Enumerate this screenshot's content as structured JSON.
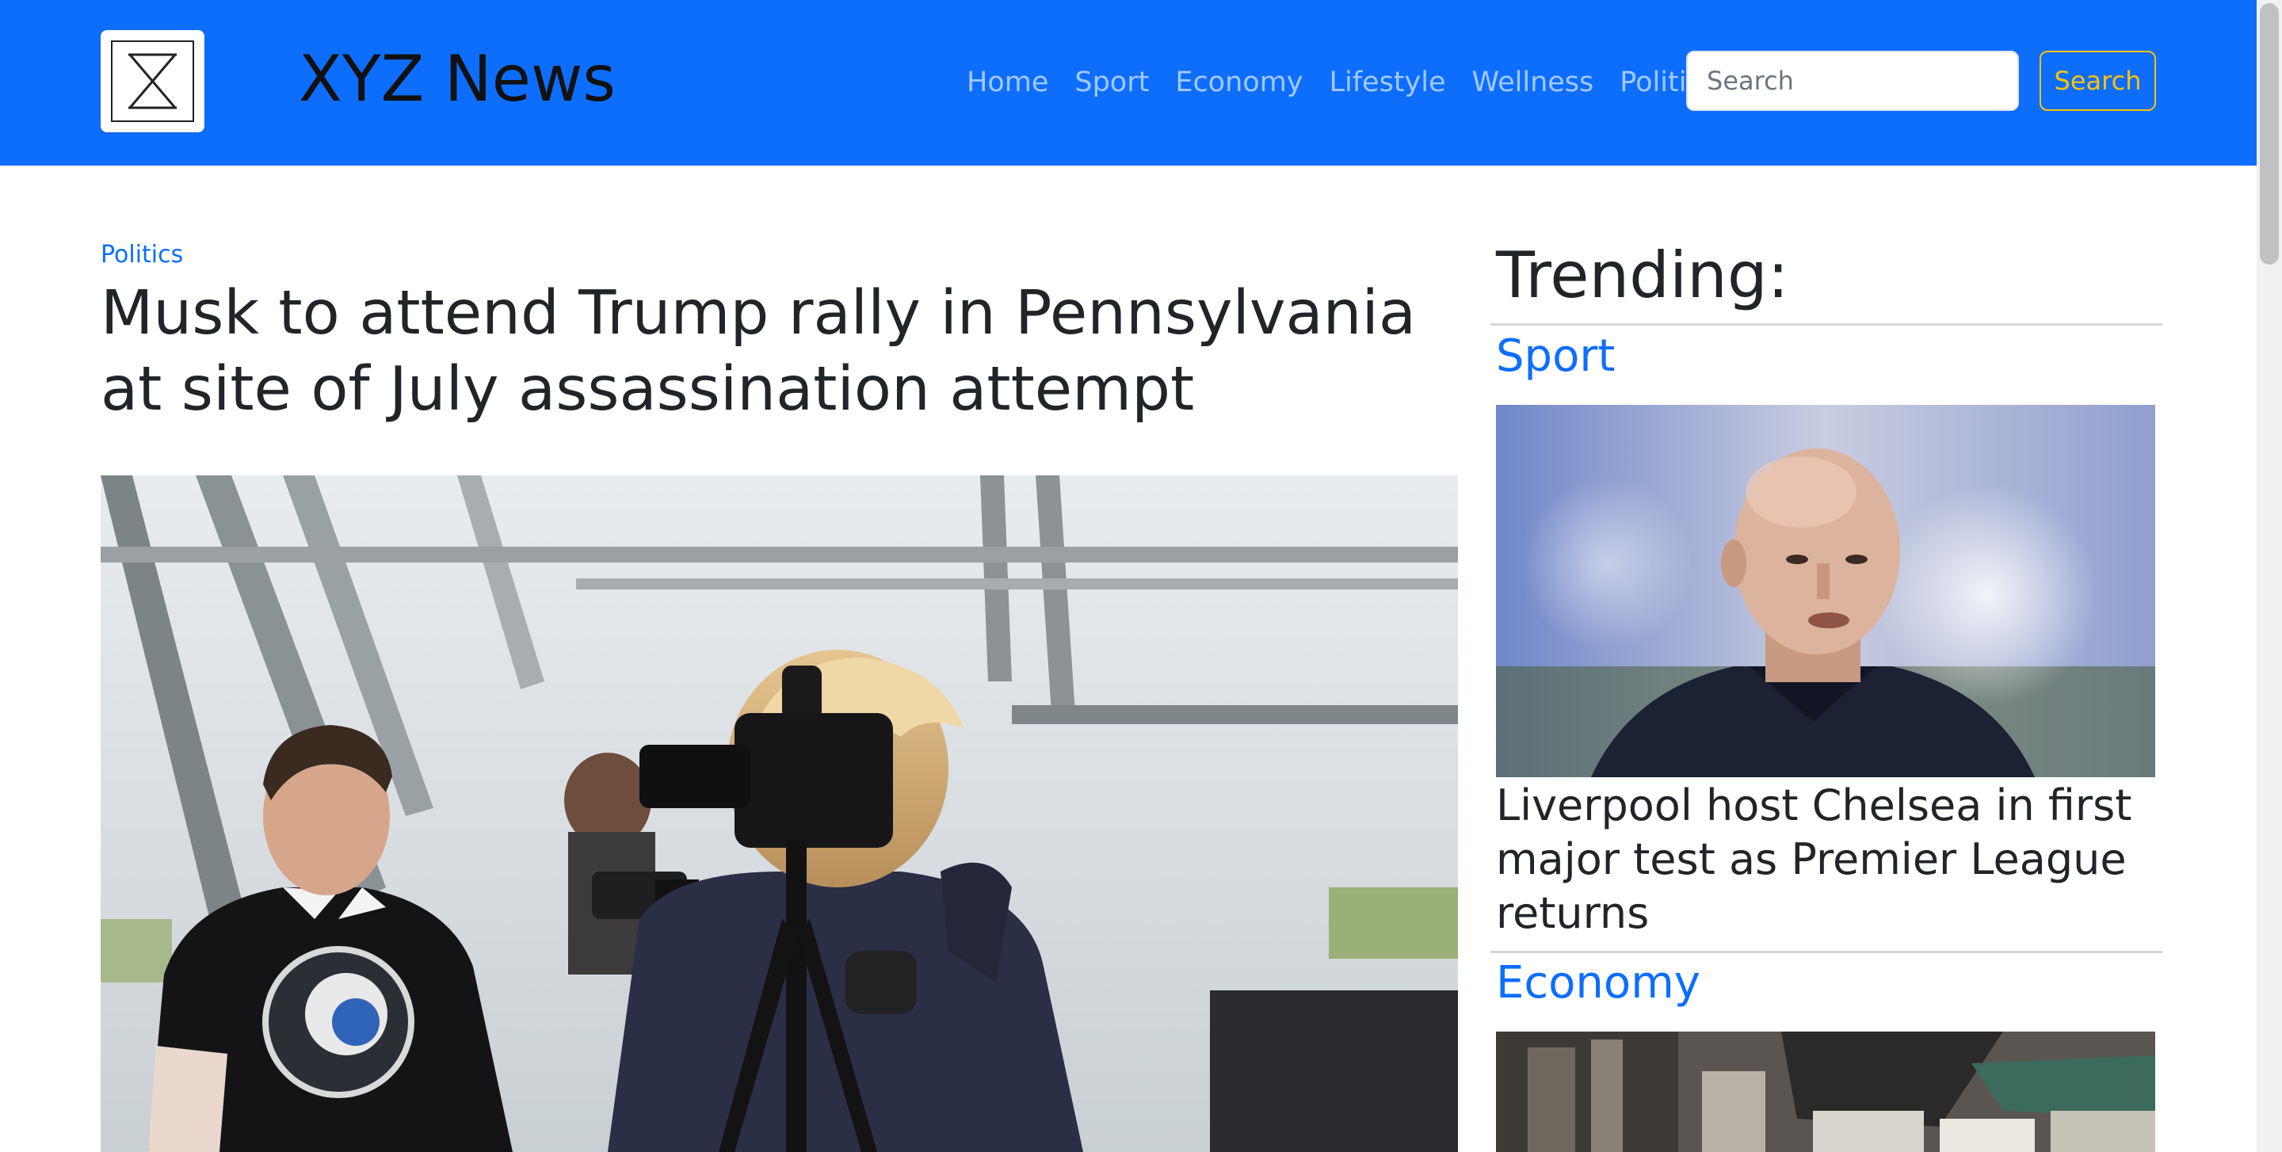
{
  "header": {
    "logo_icon": "hourglass-logo-icon",
    "brand": "XYZ News",
    "nav": [
      {
        "label": "Home"
      },
      {
        "label": "Sport"
      },
      {
        "label": "Economy"
      },
      {
        "label": "Lifestyle"
      },
      {
        "label": "Wellness"
      },
      {
        "label": "Politics"
      }
    ],
    "search": {
      "placeholder": "Search",
      "value": "",
      "button_label": "Search"
    },
    "colors": {
      "navbar_bg": "#0d6efd",
      "search_button": "#ffc107"
    }
  },
  "main": {
    "category": "Politics",
    "headline": "Musk to attend Trump rally in Pennsylvania at site of July assassination attempt"
  },
  "trending": {
    "title": "Trending:",
    "items": [
      {
        "section": "Sport",
        "headline": "Liverpool host Chelsea in first major test as Premier League returns"
      },
      {
        "section": "Economy",
        "headline": ""
      }
    ]
  }
}
